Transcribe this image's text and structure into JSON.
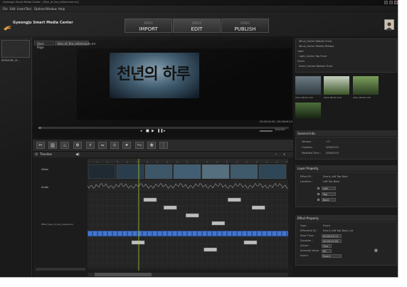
{
  "app": {
    "window_title": "Gyeongju Smart Media Center - [Mun_of_the_millennium.mr]",
    "brand_name": "Gyeongju Smart Media Center"
  },
  "menubar": [
    "File",
    "Edit",
    "Insert",
    "Tool",
    "Options",
    "Window",
    "Help"
  ],
  "steps": [
    {
      "step": "STEP.1",
      "label": "IMPORT"
    },
    {
      "step": "STEP.2",
      "label": "EDIT"
    },
    {
      "step": "STEP.3",
      "label": "PUBLISH"
    }
  ],
  "library": {
    "item_label": "KREMORE_M..."
  },
  "viewer": {
    "tabs": [
      "Start Page",
      "Dex_of_the_millennium.mr"
    ],
    "title_art": "천년의 하루",
    "timecode": "00:00:00:00 / 00:08:06:15",
    "volume": "100/100"
  },
  "timeline": {
    "title": "Timeline",
    "tracks": [
      "Video",
      "Audio",
      "Effect_Dex_of_the_millennium"
    ],
    "lower_layer": [
      0.22,
      0.58,
      0.78
    ],
    "upper_layer": [
      0.28,
      0.38,
      0.49,
      0.62,
      0.7,
      0.82
    ]
  },
  "effects_tree": {
    "items": [
      "Wind_Center Bottom Front",
      "Wind_Center Middle Midway",
      "Light",
      "Light_Center Top Front",
      "Scent",
      "Scent_Center Bottom Front"
    ]
  },
  "media": {
    "timestamps": [
      "2011.08.09 5:00",
      "2011.08.09 5:00",
      "2011.08.09 5:00"
    ]
  },
  "general_info": {
    "header": "General Info.",
    "rows": [
      [
        "Version :",
        "1.0"
      ],
      [
        "Created :",
        "5/08/2019"
      ],
      [
        "Modified Time :",
        "5/08/2019"
      ]
    ]
  },
  "layer_property": {
    "header": "Layer Property",
    "effect_id": "Effect ID :",
    "effect_value": "Event_Left Top Back",
    "location": "Location :",
    "location_value": "Left Top Back",
    "options": [
      "Left",
      "Top",
      "Back"
    ]
  },
  "effect_property": {
    "header": "Effect Property",
    "rows": [
      [
        "Type :",
        "Event"
      ],
      [
        "EffectInfo ID :",
        "Event_Left Top Back_1st"
      ],
      [
        "Start Time :",
        "00:00:02:12"
      ],
      [
        "Duration :",
        "00:00:03:00"
      ],
      [
        "Active :",
        "True"
      ],
      [
        "Intensity Value :",
        "60"
      ],
      [
        "Event :",
        "Event"
      ]
    ]
  },
  "colors": {
    "accent": "#2f63c5",
    "background": "#141414"
  }
}
